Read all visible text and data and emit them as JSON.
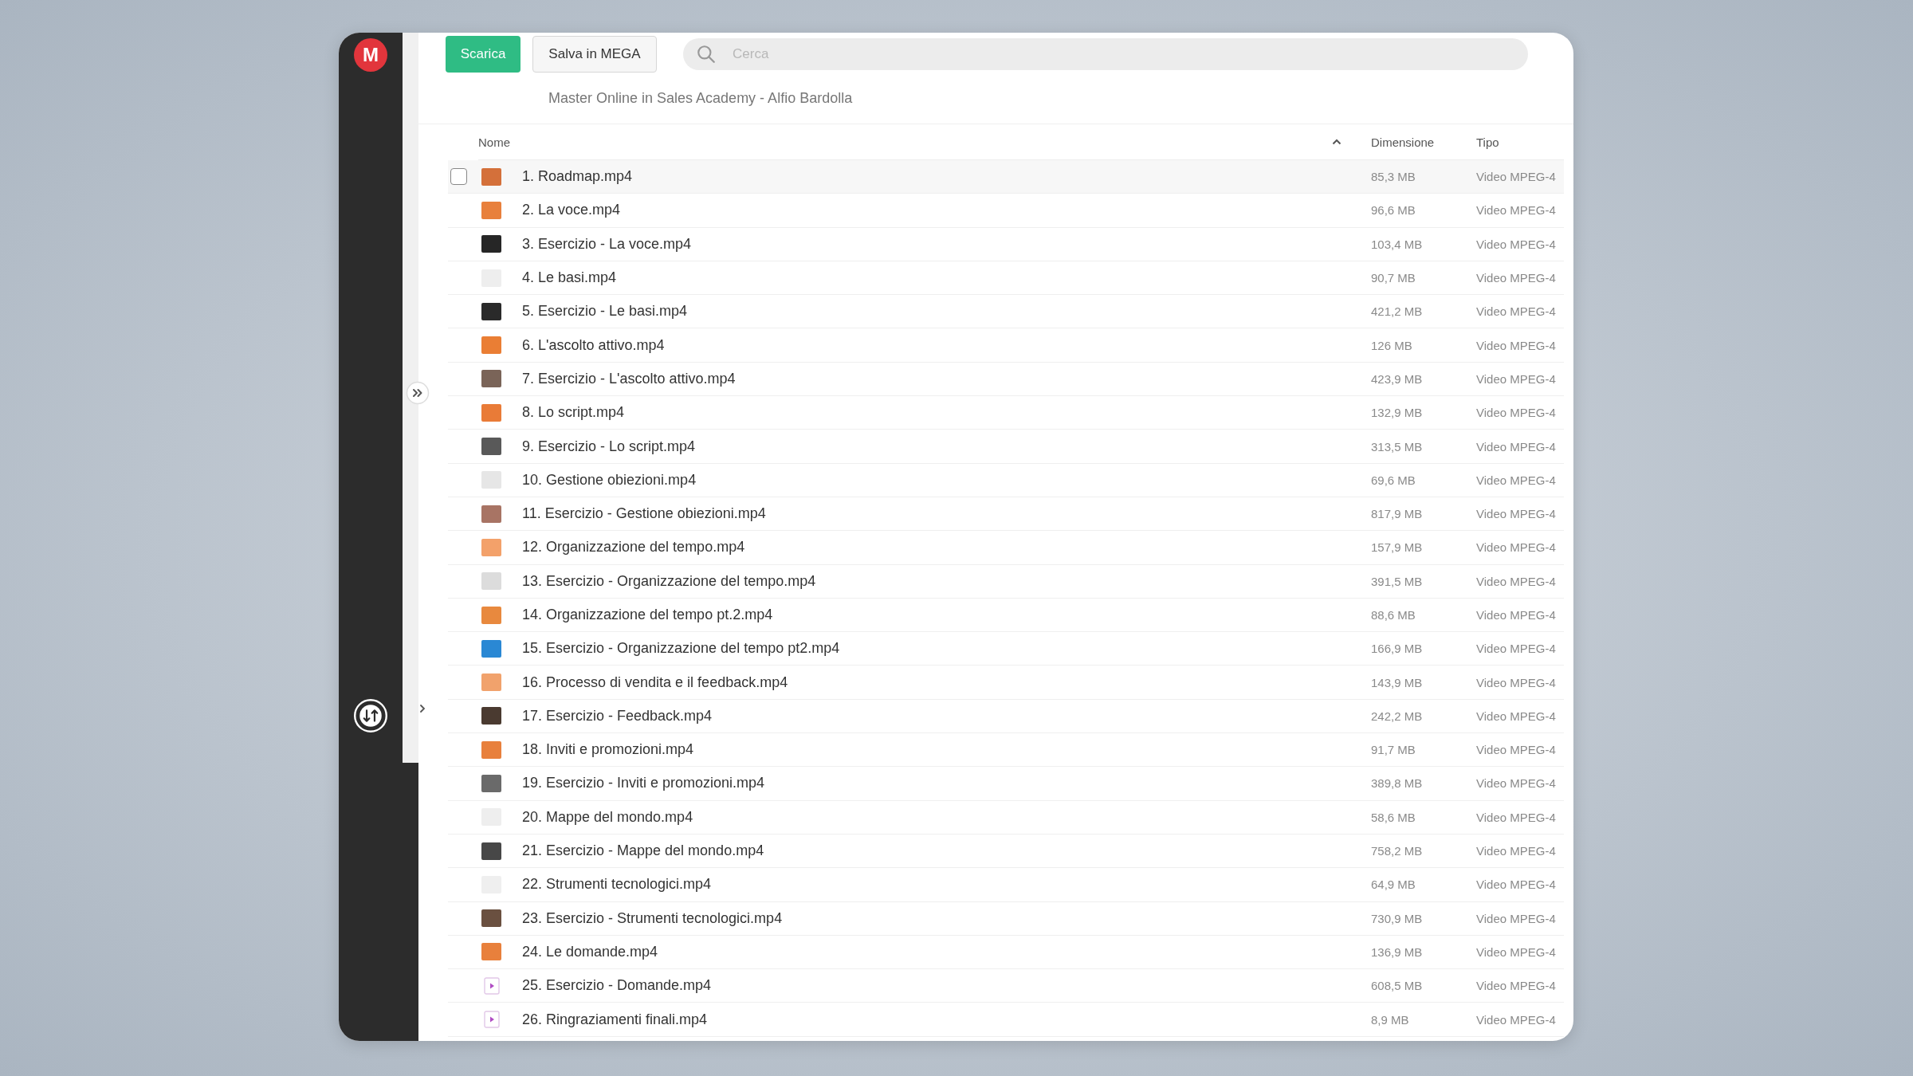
{
  "sidebar": {
    "logo": "M"
  },
  "toolbar": {
    "buttons": [
      {
        "label": "Scarica",
        "kind": "primary"
      },
      {
        "label": "Salva in MEGA",
        "kind": "secondary"
      }
    ],
    "search": {
      "placeholder": "Cerca"
    }
  },
  "folder_title": "Master Online in Sales Academy - Alfio Bardolla",
  "table": {
    "columns": [
      "Nome",
      "Dimensione",
      "Tipo"
    ],
    "rows": [
      {
        "name": "1. Roadmap.mp4",
        "size": "85,3 MB",
        "type": "Video MPEG-4",
        "hovered": true,
        "checked": false,
        "kind": "video",
        "color": "#d4703a"
      },
      {
        "name": "2. La voce.mp4",
        "size": "96,6 MB",
        "type": "Video MPEG-4",
        "hovered": false,
        "checked": false,
        "kind": "video",
        "color": "#e8803c"
      },
      {
        "name": "3. Esercizio - La voce.mp4",
        "size": "103,4 MB",
        "type": "Video MPEG-4",
        "hovered": false,
        "checked": false,
        "kind": "video",
        "color": "#262626"
      },
      {
        "name": "4. Le basi.mp4",
        "size": "90,7 MB",
        "type": "Video MPEG-4",
        "hovered": false,
        "checked": false,
        "kind": "video",
        "color": "#eeeeee"
      },
      {
        "name": "5. Esercizio - Le basi.mp4",
        "size": "421,2 MB",
        "type": "Video MPEG-4",
        "hovered": false,
        "checked": false,
        "kind": "video",
        "color": "#2a2a2a"
      },
      {
        "name": "6. L'ascolto attivo.mp4",
        "size": "126 MB",
        "type": "Video MPEG-4",
        "hovered": false,
        "checked": false,
        "kind": "video",
        "color": "#ea7e34"
      },
      {
        "name": "7. Esercizio - L'ascolto attivo.mp4",
        "size": "423,9 MB",
        "type": "Video MPEG-4",
        "hovered": false,
        "checked": false,
        "kind": "video",
        "color": "#7a6458"
      },
      {
        "name": "8. Lo script.mp4",
        "size": "132,9 MB",
        "type": "Video MPEG-4",
        "hovered": false,
        "checked": false,
        "kind": "video",
        "color": "#e97b37"
      },
      {
        "name": "9. Esercizio - Lo script.mp4",
        "size": "313,5 MB",
        "type": "Video MPEG-4",
        "hovered": false,
        "checked": false,
        "kind": "video",
        "color": "#595959"
      },
      {
        "name": "10. Gestione obiezioni.mp4",
        "size": "69,6 MB",
        "type": "Video MPEG-4",
        "hovered": false,
        "checked": false,
        "kind": "video",
        "color": "#e6e6e6"
      },
      {
        "name": "11. Esercizio - Gestione obiezioni.mp4",
        "size": "817,9 MB",
        "type": "Video MPEG-4",
        "hovered": false,
        "checked": false,
        "kind": "video",
        "color": "#a87464"
      },
      {
        "name": "12. Organizzazione del tempo.mp4",
        "size": "157,9 MB",
        "type": "Video MPEG-4",
        "hovered": false,
        "checked": false,
        "kind": "video",
        "color": "#f3a16a"
      },
      {
        "name": "13. Esercizio - Organizzazione del tempo.mp4",
        "size": "391,5 MB",
        "type": "Video MPEG-4",
        "hovered": false,
        "checked": false,
        "kind": "video",
        "color": "#dcdcdc"
      },
      {
        "name": "14. Organizzazione del tempo pt.2.mp4",
        "size": "88,6 MB",
        "type": "Video MPEG-4",
        "hovered": false,
        "checked": false,
        "kind": "video",
        "color": "#e8893e"
      },
      {
        "name": "15. Esercizio - Organizzazione del tempo pt2.mp4",
        "size": "166,9 MB",
        "type": "Video MPEG-4",
        "hovered": false,
        "checked": false,
        "kind": "video",
        "color": "#2a88d4"
      },
      {
        "name": "16. Processo di vendita e il feedback.mp4",
        "size": "143,9 MB",
        "type": "Video MPEG-4",
        "hovered": false,
        "checked": false,
        "kind": "video",
        "color": "#f1a26c"
      },
      {
        "name": "17. Esercizio - Feedback.mp4",
        "size": "242,2 MB",
        "type": "Video MPEG-4",
        "hovered": false,
        "checked": false,
        "kind": "video",
        "color": "#4a3a30"
      },
      {
        "name": "18. Inviti e promozioni.mp4",
        "size": "91,7 MB",
        "type": "Video MPEG-4",
        "hovered": false,
        "checked": false,
        "kind": "video",
        "color": "#e8803c"
      },
      {
        "name": "19. Esercizio - Inviti e promozioni.mp4",
        "size": "389,8 MB",
        "type": "Video MPEG-4",
        "hovered": false,
        "checked": false,
        "kind": "video",
        "color": "#6a6a6a"
      },
      {
        "name": "20. Mappe del mondo.mp4",
        "size": "58,6 MB",
        "type": "Video MPEG-4",
        "hovered": false,
        "checked": false,
        "kind": "video",
        "color": "#eeeeee"
      },
      {
        "name": "21. Esercizio - Mappe del mondo.mp4",
        "size": "758,2 MB",
        "type": "Video MPEG-4",
        "hovered": false,
        "checked": false,
        "kind": "video",
        "color": "#474747"
      },
      {
        "name": "22. Strumenti tecnologici.mp4",
        "size": "64,9 MB",
        "type": "Video MPEG-4",
        "hovered": false,
        "checked": false,
        "kind": "video",
        "color": "#efefef"
      },
      {
        "name": "23. Esercizio - Strumenti tecnologici.mp4",
        "size": "730,9 MB",
        "type": "Video MPEG-4",
        "hovered": false,
        "checked": false,
        "kind": "video",
        "color": "#6a5040"
      },
      {
        "name": "24. Le domande.mp4",
        "size": "136,9 MB",
        "type": "Video MPEG-4",
        "hovered": false,
        "checked": false,
        "kind": "video",
        "color": "#e8803c"
      },
      {
        "name": "25. Esercizio - Domande.mp4",
        "size": "608,5 MB",
        "type": "Video MPEG-4",
        "hovered": false,
        "checked": false,
        "kind": "file"
      },
      {
        "name": "26. Ringraziamenti finali.mp4",
        "size": "8,9 MB",
        "type": "Video MPEG-4",
        "hovered": false,
        "checked": false,
        "kind": "file"
      }
    ]
  }
}
